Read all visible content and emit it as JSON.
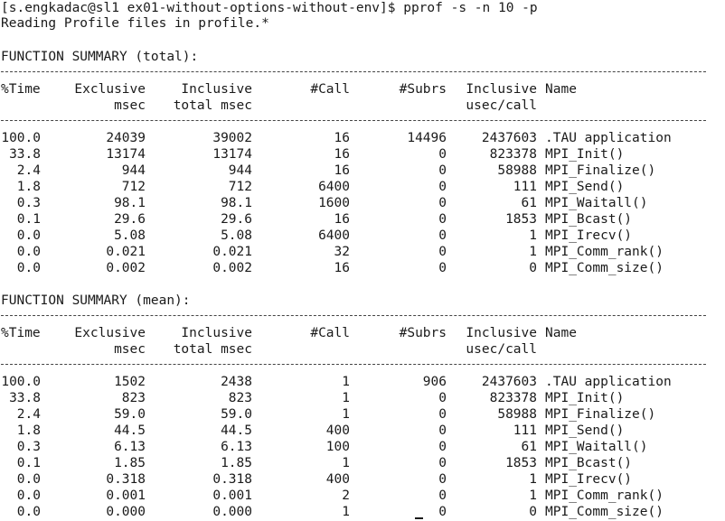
{
  "terminal": {
    "prompt_line": "[s.engkadac@sl1 ex01-without-options-without-env]$ pprof -s -n 10 -p",
    "reading_line": "Reading Profile files in profile.*"
  },
  "headers": {
    "time": "%Time",
    "exclusive": "Exclusive",
    "exclusive_unit": "msec",
    "inclusive": "Inclusive",
    "inclusive_unit": "total msec",
    "calls": "#Call",
    "subrs": "#Subrs",
    "incl_per_call": "Inclusive",
    "incl_per_call_unit": "usec/call",
    "name": "Name"
  },
  "sections": [
    {
      "title": "FUNCTION SUMMARY (total):",
      "rows": [
        [
          "100.0",
          "24039",
          "39002",
          "16",
          "14496",
          "2437603",
          ".TAU application"
        ],
        [
          "33.8",
          "13174",
          "13174",
          "16",
          "0",
          "823378",
          "MPI_Init()"
        ],
        [
          "2.4",
          "944",
          "944",
          "16",
          "0",
          "58988",
          "MPI_Finalize()"
        ],
        [
          "1.8",
          "712",
          "712",
          "6400",
          "0",
          "111",
          "MPI_Send()"
        ],
        [
          "0.3",
          "98.1",
          "98.1",
          "1600",
          "0",
          "61",
          "MPI_Waitall()"
        ],
        [
          "0.1",
          "29.6",
          "29.6",
          "16",
          "0",
          "1853",
          "MPI_Bcast()"
        ],
        [
          "0.0",
          "5.08",
          "5.08",
          "6400",
          "0",
          "1",
          "MPI_Irecv()"
        ],
        [
          "0.0",
          "0.021",
          "0.021",
          "32",
          "0",
          "1",
          "MPI_Comm_rank()"
        ],
        [
          "0.0",
          "0.002",
          "0.002",
          "16",
          "0",
          "0",
          "MPI_Comm_size()"
        ]
      ]
    },
    {
      "title": "FUNCTION SUMMARY (mean):",
      "rows": [
        [
          "100.0",
          "1502",
          "2438",
          "1",
          "906",
          "2437603",
          ".TAU application"
        ],
        [
          "33.8",
          "823",
          "823",
          "1",
          "0",
          "823378",
          "MPI_Init()"
        ],
        [
          "2.4",
          "59.0",
          "59.0",
          "1",
          "0",
          "58988",
          "MPI_Finalize()"
        ],
        [
          "1.8",
          "44.5",
          "44.5",
          "400",
          "0",
          "111",
          "MPI_Send()"
        ],
        [
          "0.3",
          "6.13",
          "6.13",
          "100",
          "0",
          "61",
          "MPI_Waitall()"
        ],
        [
          "0.1",
          "1.85",
          "1.85",
          "1",
          "0",
          "1853",
          "MPI_Bcast()"
        ],
        [
          "0.0",
          "0.318",
          "0.318",
          "400",
          "0",
          "1",
          "MPI_Irecv()"
        ],
        [
          "0.0",
          "0.001",
          "0.001",
          "2",
          "0",
          "1",
          "MPI_Comm_rank()"
        ],
        [
          "0.0",
          "0.000",
          "0.000",
          "1",
          "0",
          "0",
          "MPI_Comm_size()"
        ]
      ]
    }
  ]
}
